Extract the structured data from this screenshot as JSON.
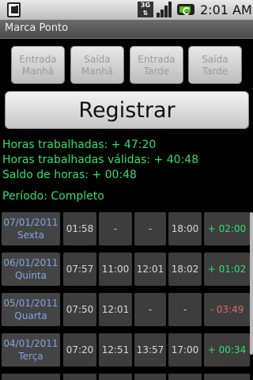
{
  "status_bar": {
    "network": "3G",
    "time": "2:01 AM"
  },
  "app_title": "Marca Ponto",
  "buttons": {
    "entrada_manha": [
      "Entrada",
      "Manhã"
    ],
    "saida_manha": [
      "Saída",
      "Manhã"
    ],
    "entrada_tarde": [
      "Entrada",
      "Tarde"
    ],
    "saida_tarde": [
      "Saída",
      "Tarde"
    ],
    "registrar": "Registrar"
  },
  "summary": {
    "horas_trabalhadas": "Horas trabalhadas: + 47:20",
    "horas_validas": "Horas trabalhadas válidas: + 40:48",
    "saldo": "Saldo de horas: + 00:48",
    "periodo": "Período: Completo"
  },
  "rows": [
    {
      "date": "07/01/2011",
      "day": "Sexta",
      "t1": "01:58",
      "t2": "-",
      "t3": "-",
      "t4": "18:00",
      "balance": "+ 02:00",
      "balance_type": "pos"
    },
    {
      "date": "06/01/2011",
      "day": "Quinta",
      "t1": "07:57",
      "t2": "11:00",
      "t3": "12:01",
      "t4": "18:02",
      "balance": "+ 01:02",
      "balance_type": "pos"
    },
    {
      "date": "05/01/2011",
      "day": "Quarta",
      "t1": "07:50",
      "t2": "12:01",
      "t3": "-",
      "t4": "-",
      "balance": "- 03:49",
      "balance_type": "neg"
    },
    {
      "date": "04/01/2011",
      "day": "Terça",
      "t1": "07:20",
      "t2": "12:51",
      "t3": "13:57",
      "t4": "17:00",
      "balance": "+ 00:34",
      "balance_type": "pos"
    }
  ],
  "colors": {
    "positive": "#2fe06c",
    "negative": "#e06a5a",
    "date": "#7fa6e4"
  }
}
